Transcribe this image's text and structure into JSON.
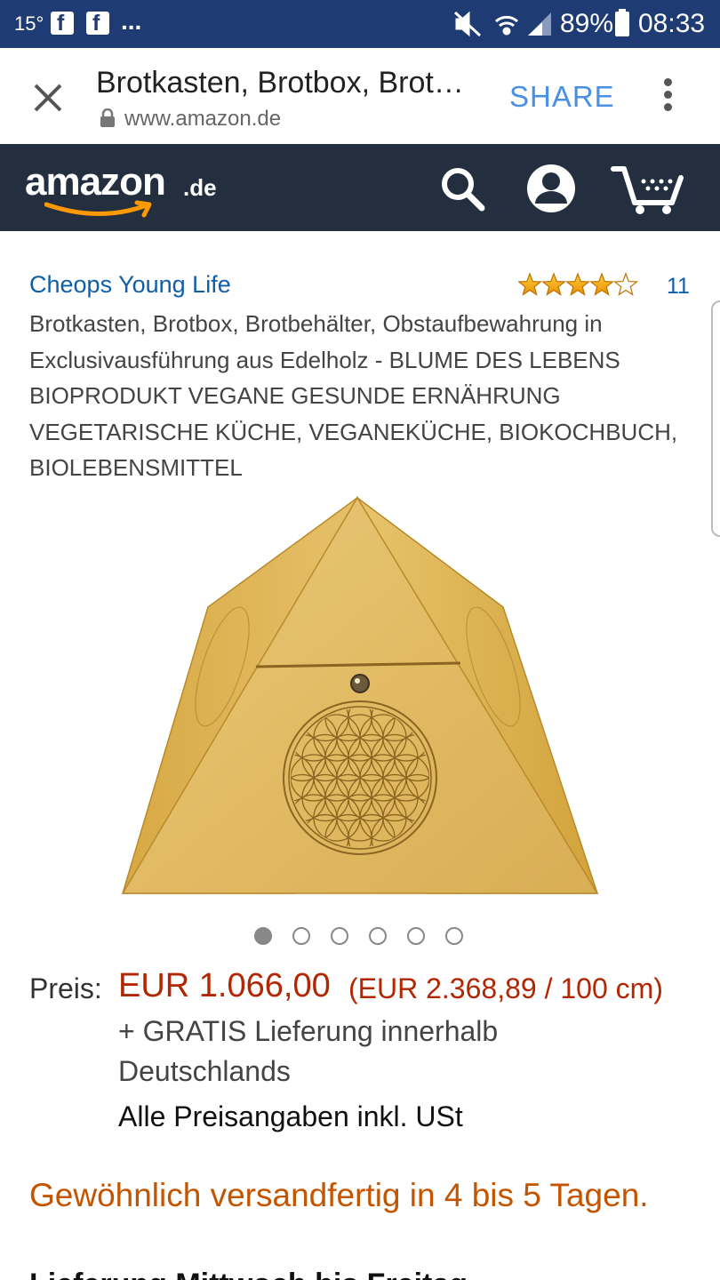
{
  "status_bar": {
    "temperature": "15°",
    "notification_icons": [
      "facebook-icon",
      "facebook-icon"
    ],
    "more": "...",
    "battery": "89%",
    "time": "08:33",
    "icons": [
      "mute-icon",
      "wifi-icon",
      "signal-icon",
      "battery-icon"
    ]
  },
  "browser": {
    "title": "Brotkasten, Brotbox, Brotbehälter, Obstaufbewahrung",
    "url": "www.amazon.de",
    "share_label": "SHARE"
  },
  "amazon_nav": {
    "logo_word": "amazon",
    "logo_tld": ".de",
    "icons": [
      "search-icon",
      "account-icon",
      "cart-icon"
    ]
  },
  "product": {
    "brand": "Cheops Young Life",
    "rating_stars": 4,
    "rating_max": 5,
    "review_count": "11",
    "title": "Brotkasten, Brotbox, Brotbehälter, Obstaufbewahrung in Exclusivausführung aus Edelholz - BLUME DES LEBENS BIOPRODUKT VEGANE GESUNDE ERNÄHRUNG VEGETARISCHE KÜCHE, VEGANEKÜCHE, BIOKOCHBUCH, BIOLEBENSMITTEL",
    "image_count": 6,
    "active_image": 1
  },
  "pricing": {
    "label": "Preis:",
    "price": "EUR 1.066,00",
    "unit_price": "(EUR 2.368,89 / 100 cm)",
    "delivery": "+ GRATIS Lieferung innerhalb Deutschlands",
    "vat_note": "Alle Preisangaben inkl. USt"
  },
  "availability": {
    "text": "Gewöhnlich versandfertig in 4 bis 5 Tagen.",
    "next_line_partial": "Lieferung Mittwoch bis Freitag"
  },
  "colors": {
    "status_bar": "#1f3b73",
    "amazon_nav": "#232f3e",
    "link": "#0f5ea8",
    "price": "#b12704",
    "availability": "#c45500",
    "share": "#4a90e2"
  }
}
